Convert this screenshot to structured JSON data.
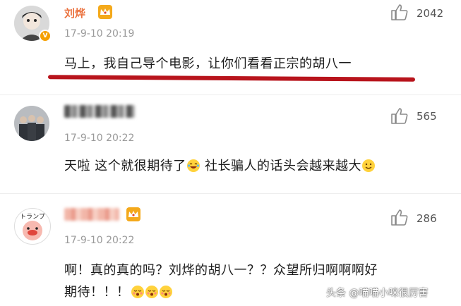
{
  "comments": [
    {
      "name": "刘烨",
      "time": "17-9-10 20:19",
      "text": "马上，我自己导个电影，让你们看看正宗的胡八一",
      "likes": "2042",
      "verified_badge": "V"
    },
    {
      "name": "",
      "time": "17-9-10 20:22",
      "text_before_emoji": "天啦 这个就很期待了",
      "text_after_emoji": " 社长骗人的话头会越来越大",
      "likes": "565"
    },
    {
      "name": "",
      "time": "17-9-10 20:22",
      "text_line1": "啊！真的真的吗？刘烨的胡八一？？众望所归啊啊啊好",
      "text_line2": "期待！！！",
      "likes": "286",
      "avatar_text": "トランプ"
    }
  ],
  "watermark": "头条 @喵喵小咪很厉害",
  "icons": {
    "like": "thumbs-up-icon",
    "vip": "crown-icon",
    "laugh": "laughing-emoji-icon",
    "smile": "smile-emoji-icon",
    "blush": "blush-emoji-icon"
  },
  "colors": {
    "vip_name": "#eb7340",
    "timestamp": "#9a9a9a",
    "underline": "#b8141c"
  }
}
